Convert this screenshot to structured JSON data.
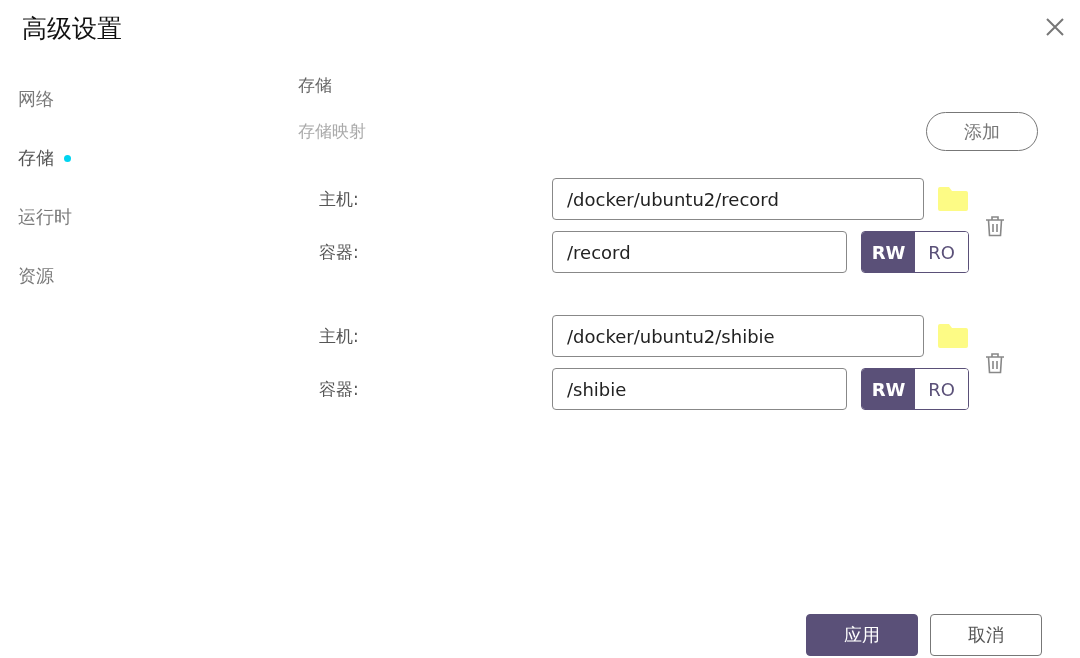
{
  "window": {
    "title": "高级设置"
  },
  "sidebar": {
    "items": [
      {
        "label": "网络",
        "selected": false
      },
      {
        "label": "存储",
        "selected": true
      },
      {
        "label": "运行时",
        "selected": false
      },
      {
        "label": "资源",
        "selected": false
      }
    ]
  },
  "content": {
    "heading": "存储",
    "section_label": "存储映射",
    "add_button": "添加",
    "mappings": [
      {
        "host_label": "主机:",
        "host_path": "/docker/ubuntu2/record",
        "container_label": "容器:",
        "container_path": "/record",
        "modes": [
          {
            "label": "RW",
            "selected": true
          },
          {
            "label": "RO",
            "selected": false
          }
        ]
      },
      {
        "host_label": "主机:",
        "host_path": "/docker/ubuntu2/shibie",
        "container_label": "容器:",
        "container_path": "/shibie",
        "modes": [
          {
            "label": "RW",
            "selected": true
          },
          {
            "label": "RO",
            "selected": false
          }
        ]
      }
    ]
  },
  "footer": {
    "buttons": [
      {
        "label": "应用",
        "kind": "primary"
      },
      {
        "label": "取消",
        "kind": "secondary"
      }
    ]
  }
}
